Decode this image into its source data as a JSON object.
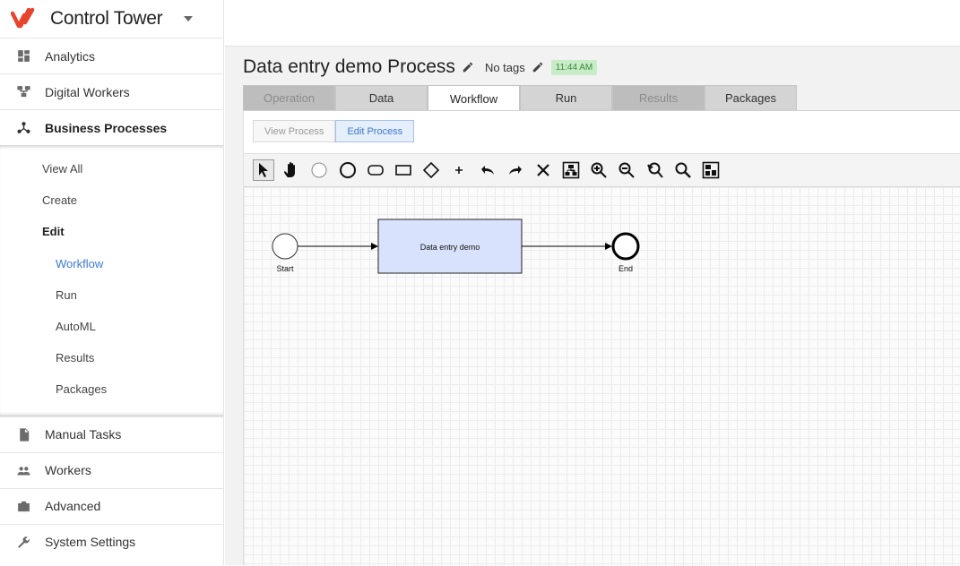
{
  "app": {
    "title": "Control Tower",
    "brand_color": "#e8442d"
  },
  "sidebar": {
    "items_top": [
      {
        "label": "Analytics",
        "icon": "dashboard-icon"
      },
      {
        "label": "Digital Workers",
        "icon": "hierarchy-icon"
      },
      {
        "label": "Business Processes",
        "icon": "process-icon"
      }
    ],
    "submenu": [
      {
        "label": "View All"
      },
      {
        "label": "Create"
      },
      {
        "label": "Edit"
      },
      {
        "label": "Workflow"
      },
      {
        "label": "Run"
      },
      {
        "label": "AutoML"
      },
      {
        "label": "Results"
      },
      {
        "label": "Packages"
      }
    ],
    "items_bottom": [
      {
        "label": "Manual Tasks",
        "icon": "document-icon"
      },
      {
        "label": "Workers",
        "icon": "people-icon"
      },
      {
        "label": "Advanced",
        "icon": "briefcase-icon"
      },
      {
        "label": "System Settings",
        "icon": "wrench-icon"
      }
    ]
  },
  "process": {
    "title": "Data entry demo Process",
    "tags": "No tags",
    "time": "11:44 AM"
  },
  "tabs": [
    {
      "label": "Operation"
    },
    {
      "label": "Data"
    },
    {
      "label": "Workflow"
    },
    {
      "label": "Run"
    },
    {
      "label": "Results"
    },
    {
      "label": "Packages"
    }
  ],
  "modes": {
    "view": "View Process",
    "edit": "Edit Process"
  },
  "toolbar": {
    "tools": [
      "pointer-icon",
      "hand-icon",
      "start-event-icon",
      "end-event-icon",
      "rounded-task-icon",
      "rectangle-icon",
      "gateway-icon",
      "plus-icon",
      "undo-icon",
      "redo-icon",
      "delete-icon",
      "auto-layout-icon",
      "zoom-in-icon",
      "zoom-out-icon",
      "zoom-reset-icon",
      "zoom-fit-icon",
      "minimap-icon"
    ]
  },
  "diagram": {
    "start_label": "Start",
    "task_label": "Data entry demo",
    "end_label": "End",
    "task_fill": "#d8e2fc"
  }
}
